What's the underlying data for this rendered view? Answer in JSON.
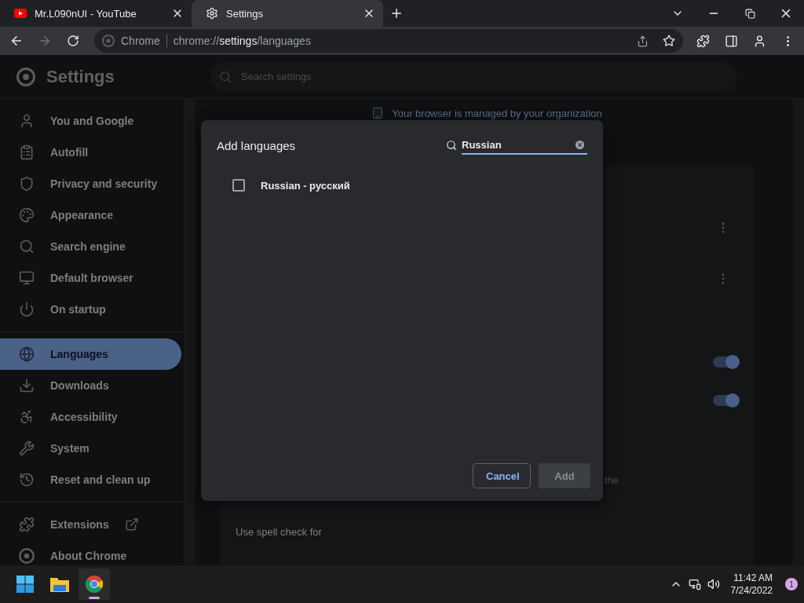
{
  "tabs": [
    {
      "title": "Mr.L090nUI - YouTube",
      "kind": "youtube",
      "selected": false
    },
    {
      "title": "Settings",
      "kind": "settings",
      "selected": true
    }
  ],
  "toolbar": {
    "forward_disabled": true,
    "chip": "Chrome",
    "url": "chrome://**settings**/languages"
  },
  "settings_header": {
    "title": "Settings",
    "search_placeholder": "Search settings"
  },
  "sidebar": {
    "groups": [
      [
        {
          "label": "You and Google",
          "kind": "person",
          "selected": false
        },
        {
          "label": "Autofill",
          "kind": "clipboard",
          "selected": false
        },
        {
          "label": "Privacy and security",
          "kind": "shield",
          "selected": false
        },
        {
          "label": "Appearance",
          "kind": "palette",
          "selected": false
        },
        {
          "label": "Search engine",
          "kind": "search",
          "selected": false
        },
        {
          "label": "Default browser",
          "kind": "browser",
          "selected": false
        },
        {
          "label": "On startup",
          "kind": "power",
          "selected": false
        }
      ],
      [
        {
          "label": "Languages",
          "kind": "globe",
          "selected": true
        },
        {
          "label": "Downloads",
          "kind": "download",
          "selected": false
        },
        {
          "label": "Accessibility",
          "kind": "accessibility",
          "selected": false
        },
        {
          "label": "System",
          "kind": "wrench",
          "selected": false
        },
        {
          "label": "Reset and clean up",
          "kind": "history",
          "selected": false
        }
      ],
      [
        {
          "label": "Extensions",
          "kind": "puzzle",
          "selected": false,
          "external": true
        },
        {
          "label": "About Chrome",
          "kind": "chrome",
          "selected": false
        }
      ]
    ]
  },
  "main": {
    "managed_notice": "Your browser is managed by your organization",
    "toggles": [
      {
        "on": true
      },
      {
        "on": true
      }
    ],
    "partial_text": "the",
    "spell_check_label": "Use spell check for"
  },
  "dialog": {
    "title": "Add languages",
    "search": {
      "value": "Russian"
    },
    "languages": [
      {
        "label": "Russian - русский",
        "checked": false
      }
    ],
    "buttons": [
      {
        "label": "Cancel",
        "kind": "secondary",
        "disabled": false
      },
      {
        "label": "Add",
        "kind": "primary",
        "disabled": true
      }
    ]
  },
  "taskbar": {
    "apps": [
      {
        "kind": "start",
        "active": false
      },
      {
        "kind": "explorer",
        "active": false
      },
      {
        "kind": "chrome",
        "active": true
      }
    ],
    "time": "11:42 AM",
    "date": "7/24/2022",
    "notifications": "1"
  }
}
